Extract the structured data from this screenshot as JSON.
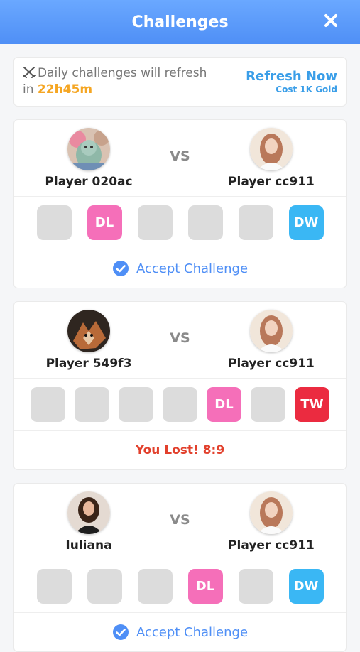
{
  "header": {
    "title": "Challenges"
  },
  "refresh": {
    "line1": "Daily challenges will refresh",
    "in_label": "in ",
    "time_left": "22h45m",
    "action": "Refresh Now",
    "cost": "Cost 1K Gold"
  },
  "vs_label": "VS",
  "challenges": [
    {
      "left": "Player 020ac",
      "right": "Player cc911",
      "slots": [
        "",
        "DL",
        "",
        "",
        "",
        "DW"
      ],
      "footer": "Accept Challenge"
    },
    {
      "left": "Player 549f3",
      "right": "Player cc911",
      "slots": [
        "",
        "",
        "",
        "",
        "DL",
        "",
        "TW"
      ],
      "footer": "You Lost! 8:9"
    },
    {
      "left": "Iuliana",
      "right": "Player cc911",
      "slots": [
        "",
        "",
        "",
        "DL",
        "",
        "DW"
      ],
      "footer": "Accept Challenge"
    }
  ],
  "colors": {
    "header": "#5a9af8",
    "accent": "#4f8ff6",
    "time": "#f5a623",
    "dl": "#f56fb9",
    "dw": "#3ab7f4",
    "tw": "#eb2b40",
    "lost": "#e2402c"
  }
}
